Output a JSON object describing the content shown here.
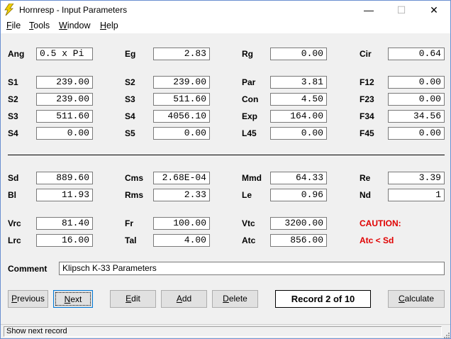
{
  "window": {
    "title": "Hornresp - Input Parameters",
    "minimize": "—",
    "maximize": "☐",
    "close": "✕"
  },
  "menu": {
    "file": {
      "key": "F",
      "rest": "ile"
    },
    "tools": {
      "key": "T",
      "rest": "ools"
    },
    "window": {
      "key": "W",
      "rest": "indow"
    },
    "help": {
      "key": "H",
      "rest": "elp"
    }
  },
  "params": {
    "ang": {
      "label": "Ang",
      "value": "0.5 x Pi"
    },
    "eg": {
      "label": "Eg",
      "value": "2.83"
    },
    "rg": {
      "label": "Rg",
      "value": "0.00"
    },
    "cir": {
      "label": "Cir",
      "value": "0.64"
    },
    "s1": {
      "label": "S1",
      "value": "239.00"
    },
    "s2_col2": {
      "label": "S2",
      "value": "239.00"
    },
    "par": {
      "label": "Par",
      "value": "3.81"
    },
    "f12": {
      "label": "F12",
      "value": "0.00"
    },
    "s2": {
      "label": "S2",
      "value": "239.00"
    },
    "s3_col2": {
      "label": "S3",
      "value": "511.60"
    },
    "con": {
      "label": "Con",
      "value": "4.50"
    },
    "f23": {
      "label": "F23",
      "value": "0.00"
    },
    "s3": {
      "label": "S3",
      "value": "511.60"
    },
    "s4_col2": {
      "label": "S4",
      "value": "4056.10"
    },
    "exp": {
      "label": "Exp",
      "value": "164.00"
    },
    "f34": {
      "label": "F34",
      "value": "34.56"
    },
    "s4": {
      "label": "S4",
      "value": "0.00"
    },
    "s5": {
      "label": "S5",
      "value": "0.00"
    },
    "l45": {
      "label": "L45",
      "value": "0.00"
    },
    "f45": {
      "label": "F45",
      "value": "0.00"
    },
    "sd": {
      "label": "Sd",
      "value": "889.60"
    },
    "cms": {
      "label": "Cms",
      "value": "2.68E-04"
    },
    "mmd": {
      "label": "Mmd",
      "value": "64.33"
    },
    "re": {
      "label": "Re",
      "value": "3.39"
    },
    "bl": {
      "label": "Bl",
      "value": "11.93"
    },
    "rms": {
      "label": "Rms",
      "value": "2.33"
    },
    "le": {
      "label": "Le",
      "value": "0.96"
    },
    "nd": {
      "label": "Nd",
      "value": "1"
    },
    "vrc": {
      "label": "Vrc",
      "value": "81.40"
    },
    "fr": {
      "label": "Fr",
      "value": "100.00"
    },
    "vtc": {
      "label": "Vtc",
      "value": "3200.00"
    },
    "lrc": {
      "label": "Lrc",
      "value": "16.00"
    },
    "tal": {
      "label": "Tal",
      "value": "4.00"
    },
    "atc": {
      "label": "Atc",
      "value": "856.00"
    }
  },
  "caution": {
    "title": "CAUTION:",
    "message": "Atc < Sd",
    "color": "#e00000"
  },
  "comment": {
    "label": "Comment",
    "value": "Klipsch K-33 Parameters"
  },
  "buttons": {
    "previous": {
      "key": "P",
      "rest": "revious"
    },
    "next": {
      "key": "N",
      "rest": "ext"
    },
    "edit": {
      "key": "E",
      "rest": "dit"
    },
    "add": {
      "key": "A",
      "rest": "dd"
    },
    "delete": {
      "key": "D",
      "rest": "elete"
    },
    "calculate": {
      "key": "C",
      "rest": "alculate"
    }
  },
  "record": {
    "text": "Record 2 of 10"
  },
  "status": {
    "text": "Show next record"
  }
}
